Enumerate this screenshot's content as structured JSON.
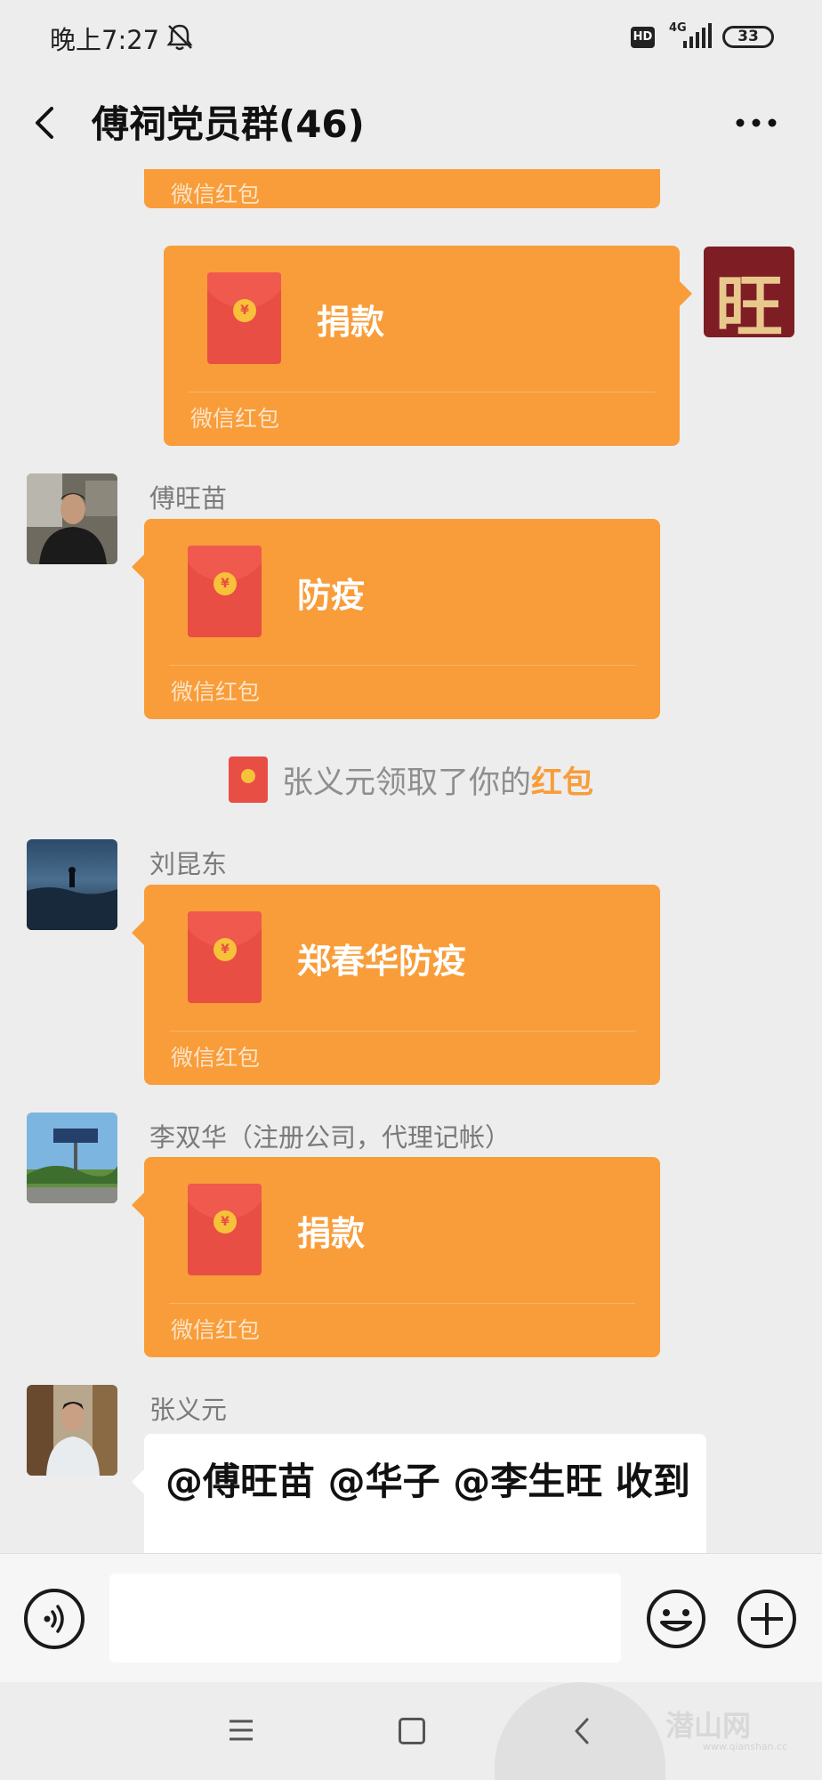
{
  "status_bar": {
    "time": "晚上7:27",
    "hd": "HD",
    "network": "4G",
    "battery": "33"
  },
  "header": {
    "title": "傅祠党员群(46)"
  },
  "messages": {
    "top_partial": {
      "footer": "微信红包"
    },
    "self_packet": {
      "title": "捐款",
      "footer": "微信红包",
      "avatar_text": "旺"
    },
    "fu_wangmiao": {
      "sender": "傅旺苗",
      "title": "防疫",
      "footer": "微信红包"
    },
    "system": {
      "text": "张义元领取了你的",
      "link": "红包"
    },
    "liu_kundong": {
      "sender": "刘昆东",
      "title": "郑春华防疫",
      "footer": "微信红包"
    },
    "li_shuanghua": {
      "sender": "李双华（注册公司，代理记帐）",
      "title": "捐款",
      "footer": "微信红包"
    },
    "zhang_yiyuan": {
      "sender": "张义元",
      "text": "@傅旺苗  @华子  @李生旺 收到"
    }
  },
  "input_bar": {
    "placeholder": ""
  },
  "watermark": {
    "main": "潜山网",
    "sub": "www.qianshan.cc"
  },
  "colors": {
    "background": "#ededed",
    "red_packet": "#f89d3a",
    "envelope": "#e84e43",
    "coin": "#f8c13a",
    "link": "#f89d3a"
  },
  "icons": {
    "mute": "bell-off-icon",
    "back": "chevron-left-icon",
    "more": "more-dots-icon",
    "voice": "voice-icon",
    "emoji": "emoji-icon",
    "plus": "plus-icon"
  }
}
